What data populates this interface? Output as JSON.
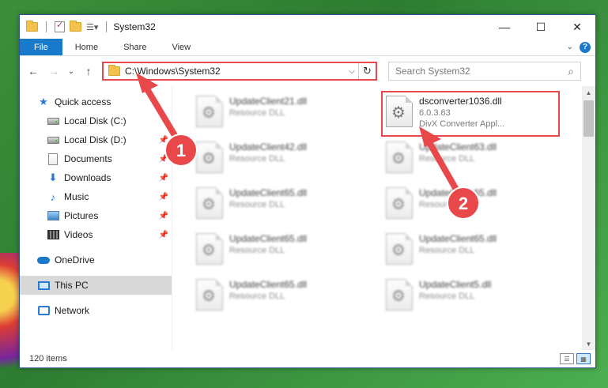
{
  "window": {
    "title": "System32",
    "controls": {
      "minimize": "—",
      "maximize": "☐",
      "close": "✕"
    }
  },
  "ribbon": {
    "tabs": [
      "File",
      "Home",
      "Share",
      "View"
    ],
    "expand_icon": "chevron-down-icon",
    "help_icon": "?"
  },
  "navigation": {
    "back": "←",
    "forward": "→",
    "recent": "⌄",
    "up": "↑",
    "address": "C:\\Windows\\System32",
    "address_dropdown": "⌵",
    "refresh": "↻",
    "search_placeholder": "Search System32",
    "search_icon": "⌕"
  },
  "sidebar": {
    "items": [
      {
        "label": "Quick access",
        "icon": "star-icon"
      },
      {
        "label": "Local Disk (C:)",
        "icon": "disk-icon"
      },
      {
        "label": "Local Disk (D:)",
        "icon": "disk-icon",
        "pinned": true
      },
      {
        "label": "Documents",
        "icon": "documents-icon",
        "pinned": true
      },
      {
        "label": "Downloads",
        "icon": "downloads-icon",
        "pinned": true
      },
      {
        "label": "Music",
        "icon": "music-icon",
        "pinned": true
      },
      {
        "label": "Pictures",
        "icon": "pictures-icon",
        "pinned": true
      },
      {
        "label": "Videos",
        "icon": "videos-icon",
        "pinned": true
      },
      {
        "label": "OneDrive",
        "icon": "onedrive-icon"
      },
      {
        "label": "This PC",
        "icon": "this-pc-icon",
        "selected": true
      },
      {
        "label": "Network",
        "icon": "network-icon"
      }
    ],
    "pin_glyph": "📌"
  },
  "files": {
    "left_column": [
      {
        "name": "UpdateClient21.dll",
        "type": "Resource DLL"
      },
      {
        "name": "UpdateClient42.dll",
        "type": "Resource DLL"
      },
      {
        "name": "UpdateClient65.dll",
        "type": "Resource DLL"
      },
      {
        "name": "UpdateClient65.dll",
        "type": "Resource DLL"
      },
      {
        "name": "UpdateClient65.dll",
        "type": "Resource DLL"
      }
    ],
    "right_column": [
      {
        "name": "dsconverter1036.dll",
        "version": "6.0.3.63",
        "type": "DivX Converter Appl..."
      },
      {
        "name": "UpdateClient63.dll",
        "type": "Resource DLL"
      },
      {
        "name": "UpdateClient65.dll",
        "type": "Resource DLL"
      },
      {
        "name": "UpdateClient65.dll",
        "type": "Resource DLL"
      },
      {
        "name": "UpdateClient5.dll",
        "type": "Resource DLL"
      }
    ]
  },
  "status": {
    "item_count": "120 items"
  },
  "annotations": {
    "step1": "1",
    "step2": "2",
    "color": "#e8484a"
  }
}
